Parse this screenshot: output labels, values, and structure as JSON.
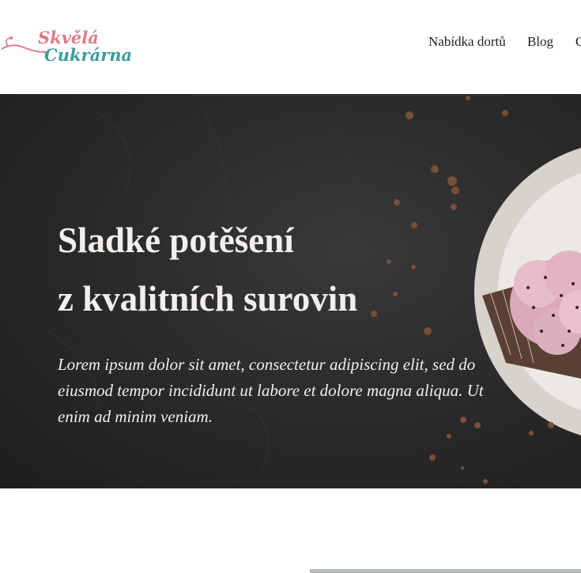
{
  "brand": {
    "line1": "Skvělá",
    "line2": "Cukrárna",
    "colors": {
      "pink": "#e07a86",
      "teal": "#3e9a9b"
    }
  },
  "nav": {
    "items": [
      "Nabídka dortů",
      "Blog",
      "C"
    ]
  },
  "hero": {
    "title_line1": "Sladké potěšení",
    "title_line2": "z kvalitních surovin",
    "text": "Lorem ipsum dolor sit amet, consectetur adipiscing elit, sed do eiusmod tempor incididunt ut labore et dolore magna aliqua. Ut enim ad minim veniam.",
    "image": "cupcake-on-dark-background"
  }
}
